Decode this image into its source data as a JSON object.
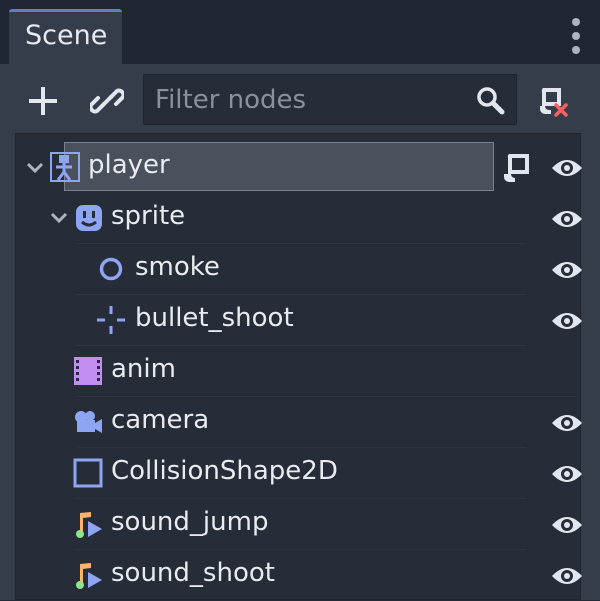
{
  "tab": {
    "title": "Scene"
  },
  "toolbar": {
    "filter_placeholder": "Filter nodes"
  },
  "colors": {
    "accent": "#5e7fc3",
    "node_blue": "#8da5f3",
    "anim_purple": "#c38ef1",
    "detach_red": "#ff5f5f"
  },
  "nodes": [
    {
      "label": "player",
      "icon": "kinematic-body-icon",
      "expanded": true,
      "selected": true,
      "has_script": true,
      "visible_toggle": true
    },
    {
      "label": "sprite",
      "icon": "sprite-icon",
      "expanded": true,
      "visible_toggle": true
    },
    {
      "label": "smoke",
      "icon": "particles-icon",
      "visible_toggle": true
    },
    {
      "label": "bullet_shoot",
      "icon": "position2d-icon",
      "visible_toggle": true
    },
    {
      "label": "anim",
      "icon": "animation-player-icon",
      "visible_toggle": false
    },
    {
      "label": "camera",
      "icon": "camera-icon",
      "visible_toggle": true
    },
    {
      "label": "CollisionShape2D",
      "icon": "collision-shape-icon",
      "visible_toggle": true
    },
    {
      "label": "sound_jump",
      "icon": "audio-player-icon",
      "visible_toggle": true
    },
    {
      "label": "sound_shoot",
      "icon": "audio-player-icon",
      "visible_toggle": true
    }
  ]
}
